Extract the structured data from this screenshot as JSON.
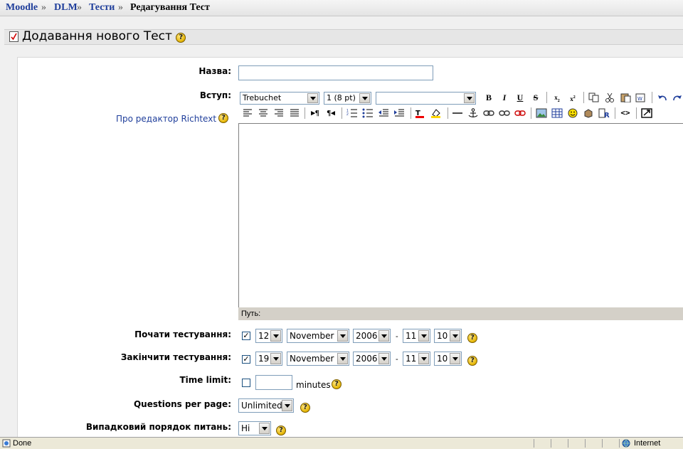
{
  "breadcrumb": {
    "items": [
      "Moodle",
      "DLM",
      "Тести"
    ],
    "current": "Редагування Тест",
    "separator": "»"
  },
  "heading": {
    "title": "Додавання нового Тест"
  },
  "form": {
    "name_label": "Назва:",
    "name_value": "",
    "intro_label": "Вступ:",
    "richtext_help_link": "Про редактор Richtext",
    "editor": {
      "font_family": "Trebuchet",
      "font_size": "1 (8 pt)",
      "heading": "",
      "path_label": "Путь:"
    },
    "open": {
      "label": "Почати тестування:",
      "enabled": true,
      "day": "12",
      "month": "November",
      "year": "2006",
      "hour": "11",
      "minute": "10"
    },
    "close": {
      "label": "Закінчити тестування:",
      "enabled": true,
      "day": "19",
      "month": "November",
      "year": "2006",
      "hour": "11",
      "minute": "10"
    },
    "time_separator": "-",
    "time_limit": {
      "label": "Time limit:",
      "enabled": false,
      "value": "",
      "unit": "minutes"
    },
    "questions_per_page": {
      "label": "Questions per page:",
      "value": "Unlimited"
    },
    "shuffle_questions": {
      "label": "Випадковий порядок питань:",
      "value": "Ні"
    }
  },
  "statusbar": {
    "status": "Done",
    "zone": "Internet"
  },
  "colors": {
    "link": "#1f3e9b",
    "help_icon": "#e4b400",
    "panel": "#ffffff",
    "page_bg": "#f0f0f0"
  }
}
